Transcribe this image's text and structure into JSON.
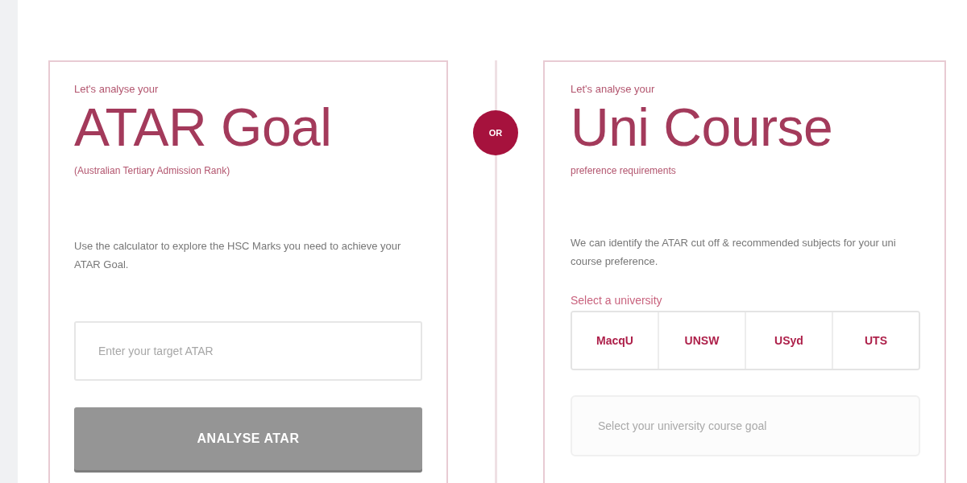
{
  "atar_card": {
    "eyebrow": "Let's analyse your",
    "title": "ATAR Goal",
    "subtitle": "(Australian Tertiary Admission Rank)",
    "description": "Use the calculator to explore the HSC Marks you need to achieve your ATAR Goal.",
    "input": {
      "placeholder": "Enter your target ATAR"
    },
    "button": {
      "label": "ANALYSE ATAR",
      "disabled": true
    }
  },
  "divider": {
    "label": "OR"
  },
  "uni_card": {
    "eyebrow": "Let's analyse your",
    "title": "Uni Course",
    "subtitle": "preference requirements",
    "description": "We can identify the ATAR cut off & recommended subjects for your uni course preference.",
    "university_label": "Select a university",
    "universities": [
      {
        "label": "MacqU",
        "selected": false
      },
      {
        "label": "UNSW",
        "selected": false
      },
      {
        "label": "USyd",
        "selected": false
      },
      {
        "label": "UTS",
        "selected": false
      }
    ],
    "course_select": {
      "placeholder": "Select your university course goal",
      "disabled": true
    }
  }
}
